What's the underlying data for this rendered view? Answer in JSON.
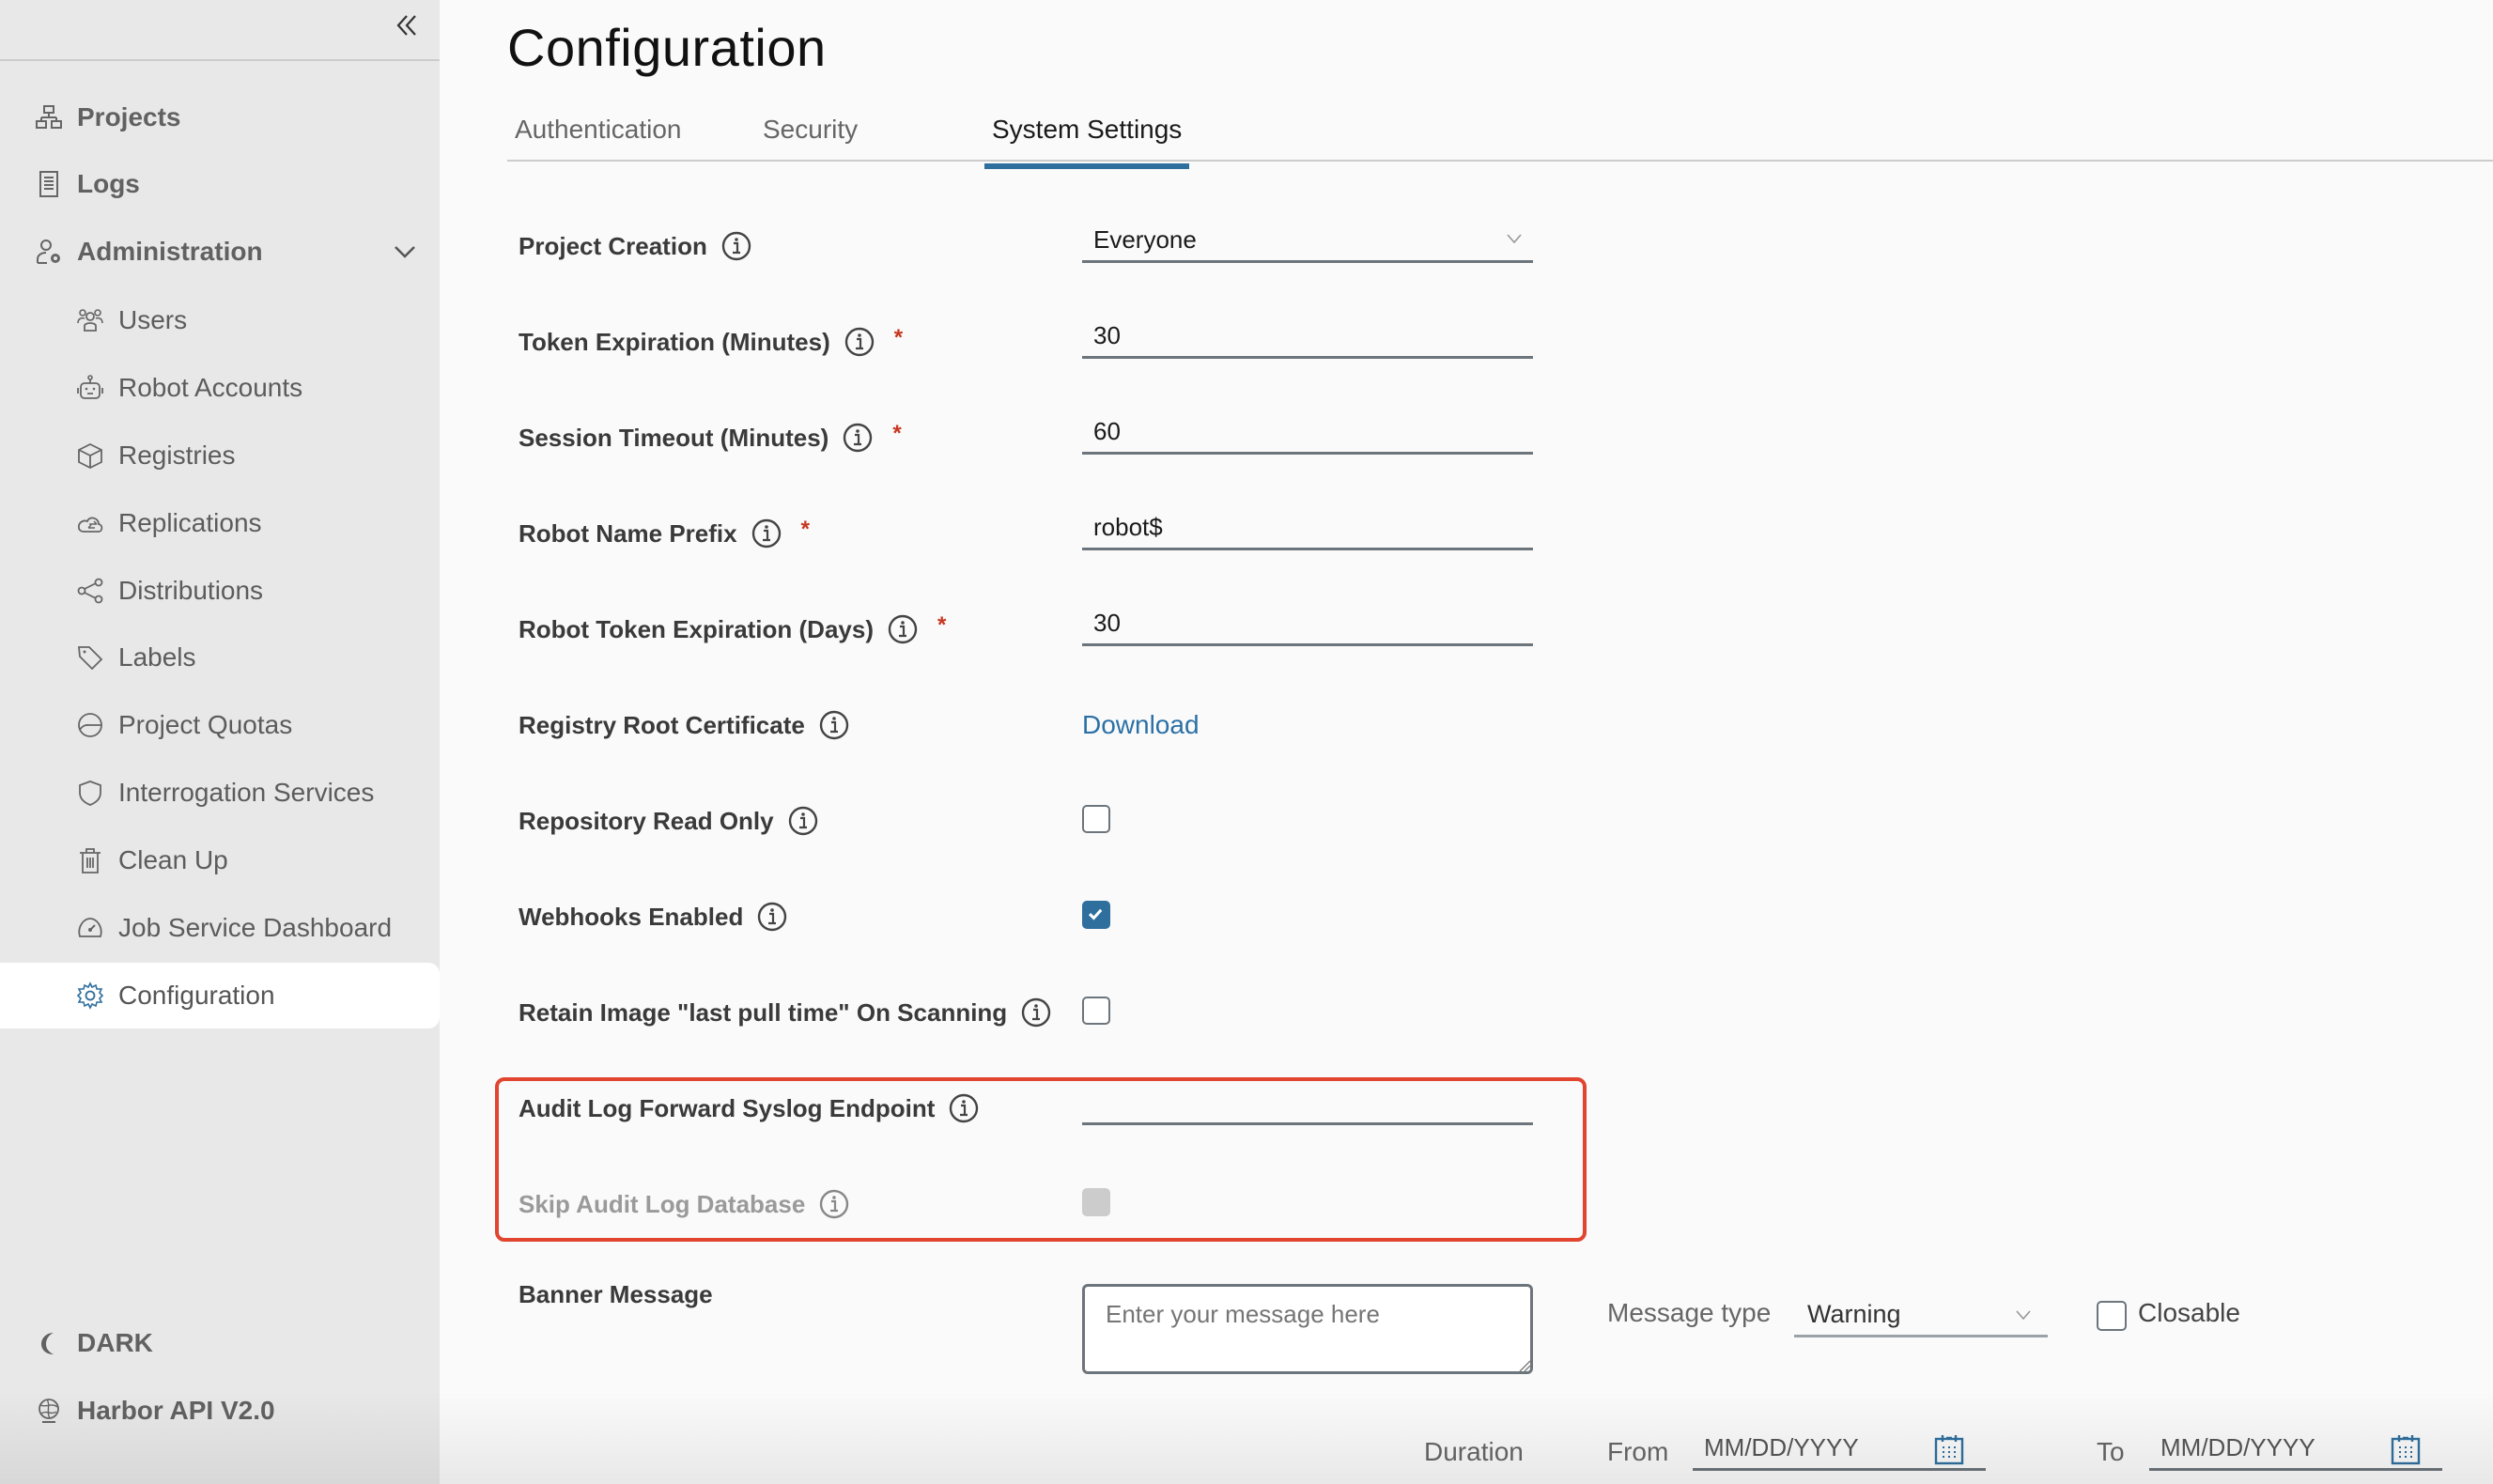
{
  "sidebar": {
    "collapse_icon": "double-chevron-left-icon",
    "items": [
      {
        "label": "Projects",
        "icon": "projects-hierarchy-icon",
        "level": "top"
      },
      {
        "label": "Logs",
        "icon": "logs-list-icon",
        "level": "top"
      },
      {
        "label": "Administration",
        "icon": "admin-user-gear-icon",
        "level": "top",
        "expanded": true
      },
      {
        "label": "Users",
        "icon": "users-group-icon",
        "level": "sub"
      },
      {
        "label": "Robot Accounts",
        "icon": "robot-icon",
        "level": "sub"
      },
      {
        "label": "Registries",
        "icon": "cube-icon",
        "level": "sub"
      },
      {
        "label": "Replications",
        "icon": "cloud-sync-icon",
        "level": "sub"
      },
      {
        "label": "Distributions",
        "icon": "share-icon",
        "level": "sub"
      },
      {
        "label": "Labels",
        "icon": "tag-icon",
        "level": "sub"
      },
      {
        "label": "Project Quotas",
        "icon": "pie-gauge-icon",
        "level": "sub"
      },
      {
        "label": "Interrogation Services",
        "icon": "shield-icon",
        "level": "sub"
      },
      {
        "label": "Clean Up",
        "icon": "trash-icon",
        "level": "sub"
      },
      {
        "label": "Job Service Dashboard",
        "icon": "dashboard-gauge-icon",
        "level": "sub"
      },
      {
        "label": "Configuration",
        "icon": "gear-icon",
        "level": "sub",
        "active": true
      }
    ],
    "footer": [
      {
        "label": "DARK",
        "icon": "moon-icon"
      },
      {
        "label": "Harbor API V2.0",
        "icon": "globe-icon"
      }
    ]
  },
  "page": {
    "title": "Configuration",
    "tabs": [
      {
        "label": "Authentication",
        "active": false
      },
      {
        "label": "Security",
        "active": false
      },
      {
        "label": "System Settings",
        "active": true
      }
    ]
  },
  "form": {
    "project_creation": {
      "label": "Project Creation",
      "value": "Everyone",
      "required": false
    },
    "token_expiration": {
      "label": "Token Expiration (Minutes)",
      "value": "30",
      "required": true
    },
    "session_timeout": {
      "label": "Session Timeout (Minutes)",
      "value": "60",
      "required": true
    },
    "robot_name_prefix": {
      "label": "Robot Name Prefix",
      "value": "robot$",
      "required": true
    },
    "robot_token_expiration": {
      "label": "Robot Token Expiration (Days)",
      "value": "30",
      "required": true
    },
    "registry_root_cert": {
      "label": "Registry Root Certificate",
      "link": "Download"
    },
    "repository_read_only": {
      "label": "Repository Read Only",
      "checked": false
    },
    "webhooks_enabled": {
      "label": "Webhooks Enabled",
      "checked": true
    },
    "retain_last_pull": {
      "label": "Retain Image \"last pull time\" On Scanning",
      "checked": false
    },
    "audit_log_endpoint": {
      "label": "Audit Log Forward Syslog Endpoint",
      "value": ""
    },
    "skip_audit_log_db": {
      "label": "Skip Audit Log Database",
      "checked": false,
      "disabled": true
    },
    "banner": {
      "label": "Banner Message",
      "placeholder": "Enter your message here",
      "message_type_label": "Message type",
      "message_type_value": "Warning",
      "closable_label": "Closable",
      "closable_checked": false,
      "duration_label": "Duration",
      "from_label": "From",
      "from_placeholder": "MM/DD/YYYY",
      "to_label": "To",
      "to_placeholder": "MM/DD/YYYY"
    },
    "required_mark": "*"
  },
  "colors": {
    "accent": "#2f6f9e",
    "required": "#c6371f",
    "highlight_box": "#e1442f",
    "sidebar_bg": "#e8e8e8",
    "main_bg": "#fafafa"
  }
}
